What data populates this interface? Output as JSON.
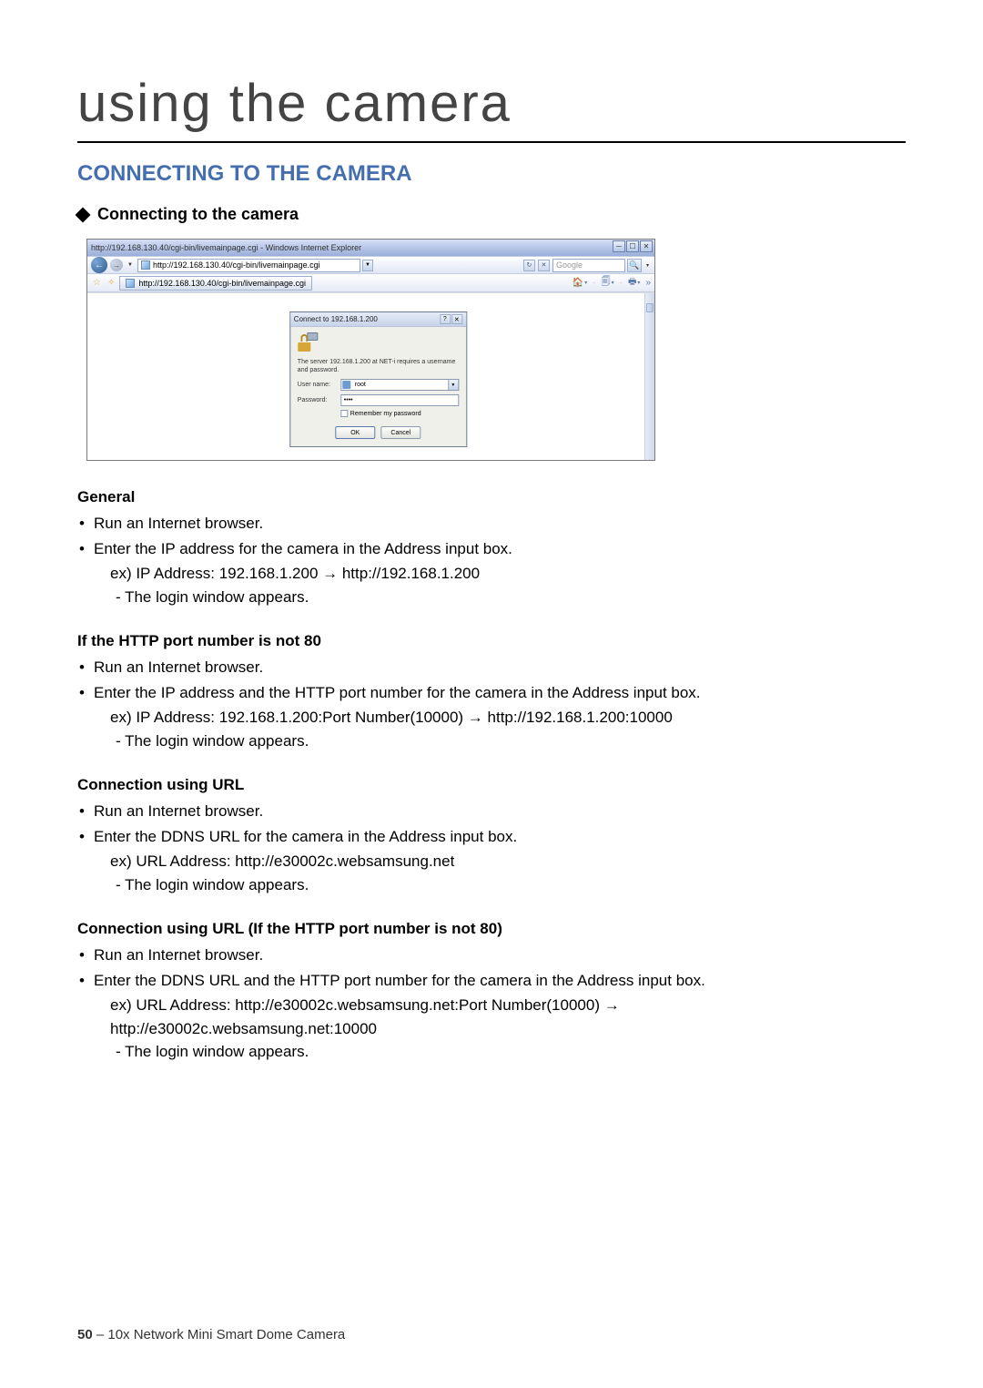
{
  "chapter_title": "using the camera",
  "section_title": "CONNECTING TO THE CAMERA",
  "subsection_title": "Connecting to the camera",
  "ie": {
    "title": "http://192.168.130.40/cgi-bin/livemainpage.cgi - Windows Internet Explorer",
    "url": "http://192.168.130.40/cgi-bin/livemainpage.cgi",
    "search_placeholder": "Google",
    "tab": "http://192.168.130.40/cgi-bin/livemainpage.cgi"
  },
  "auth": {
    "title": "Connect to 192.168.1.200",
    "message": "The server 192.168.1.200 at NET-i requires a username and password.",
    "user_label": "User name:",
    "user_value": "root",
    "pass_label": "Password:",
    "pass_value": "••••",
    "remember": "Remember my password",
    "ok": "OK",
    "cancel": "Cancel"
  },
  "blocks": [
    {
      "title": "General",
      "items": [
        {
          "main": "Run an Internet browser."
        },
        {
          "main": "Enter the IP address for the camera in the Address input box.",
          "sub": "ex) IP Address: 192.168.1.200 → http://192.168.1.200",
          "dash": "- The login window appears."
        }
      ]
    },
    {
      "title": "If the HTTP port number is not 80",
      "items": [
        {
          "main": "Run an Internet browser."
        },
        {
          "main": "Enter the IP address and the HTTP port number for the camera in the Address input box.",
          "sub": "ex) IP Address: 192.168.1.200:Port Number(10000) → http://192.168.1.200:10000",
          "dash": "- The login window appears."
        }
      ]
    },
    {
      "title": "Connection using URL",
      "items": [
        {
          "main": "Run an Internet browser."
        },
        {
          "main": "Enter the DDNS URL for the camera in the Address input box.",
          "sub": "ex) URL Address: http://e30002c.websamsung.net",
          "dash": "- The login window appears."
        }
      ]
    },
    {
      "title": "Connection using URL (If the HTTP port number is not 80)",
      "items": [
        {
          "main": "Run an Internet browser."
        },
        {
          "main": "Enter the DDNS URL and the HTTP port number for the camera in the Address input box.",
          "sub": "ex) URL Address: http://e30002c.websamsung.net:Port Number(10000) →",
          "sub2": "http://e30002c.websamsung.net:10000",
          "dash": "- The login window appears."
        }
      ]
    }
  ],
  "footer": {
    "page": "50",
    "sep": " – ",
    "doc": "10x Network Mini Smart Dome Camera"
  }
}
